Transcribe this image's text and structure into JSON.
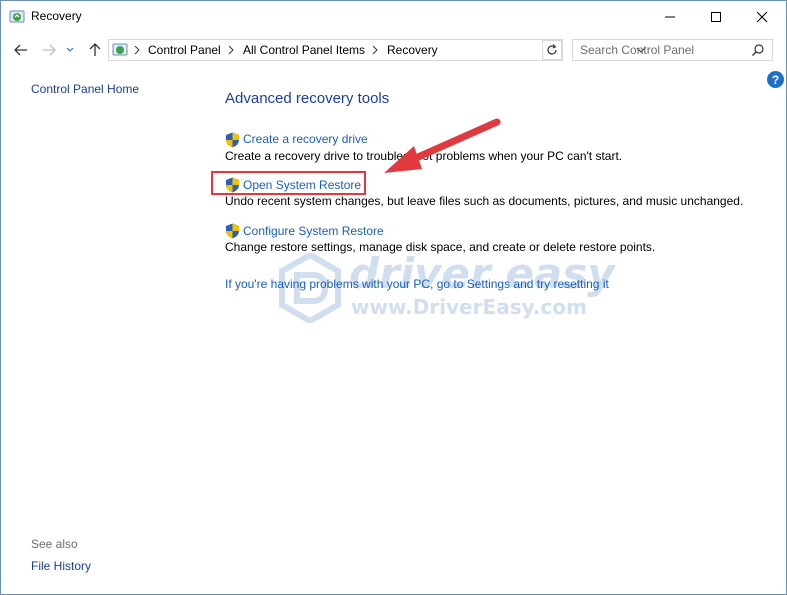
{
  "window": {
    "title": "Recovery",
    "title_icon": "recovery-icon",
    "controls": [
      "minimize-icon",
      "maximize-icon",
      "close-icon"
    ]
  },
  "address_bar": {
    "breadcrumbs": [
      "Control Panel",
      "All Control Panel Items",
      "Recovery"
    ],
    "search_placeholder": "Search Control Panel"
  },
  "sidebar": {
    "home_link": "Control Panel Home",
    "see_also_label": "See also",
    "see_also_links": [
      "File History"
    ]
  },
  "main": {
    "heading": "Advanced recovery tools",
    "items": [
      {
        "link": "Create a recovery drive",
        "description": "Create a recovery drive to troubleshoot problems when your PC can't start."
      },
      {
        "link": "Open System Restore",
        "description": "Undo recent system changes, but leave files such as documents, pictures, and music unchanged."
      },
      {
        "link": "Configure System Restore",
        "description": "Change restore settings, manage disk space, and create or delete restore points."
      }
    ],
    "settings_link": "If you're having problems with your PC, go to Settings and try resetting it"
  },
  "help": {
    "label": "?"
  },
  "watermark": {
    "brand": "driver easy",
    "url": "www.DriverEasy.com"
  },
  "colors": {
    "link": "#1a5fb4",
    "heading": "#1e3f9b",
    "highlight": "#e0393e",
    "arrow": "#e0393e"
  }
}
